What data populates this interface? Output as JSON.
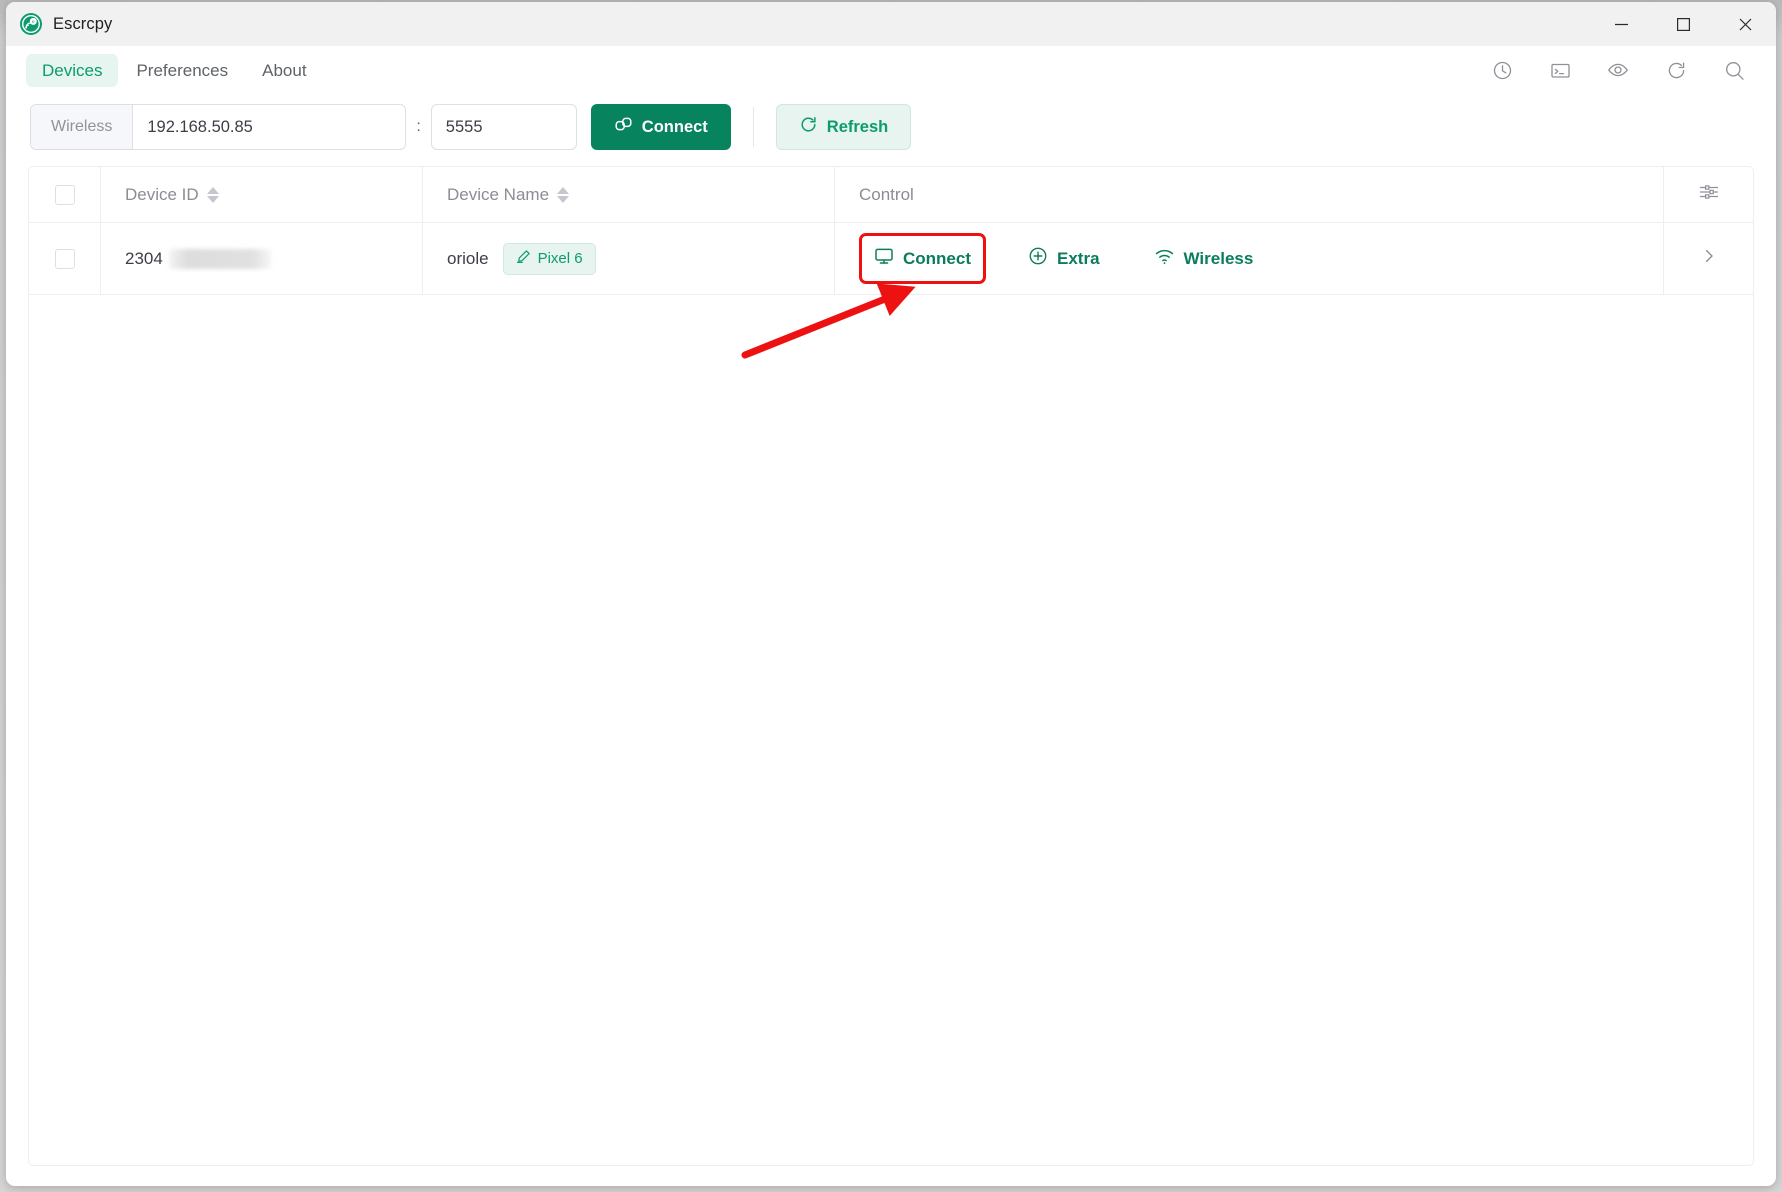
{
  "window": {
    "title": "Escrcpy",
    "logo_icon": "escrcpy-logo-icon",
    "controls": {
      "minimize": "minimize-icon",
      "maximize": "maximize-icon",
      "close": "close-icon"
    }
  },
  "tabs": [
    {
      "label": "Devices",
      "active": true
    },
    {
      "label": "Preferences",
      "active": false
    },
    {
      "label": "About",
      "active": false
    }
  ],
  "toolbar_icons": [
    {
      "name": "history-icon"
    },
    {
      "name": "terminal-icon"
    },
    {
      "name": "eye-icon"
    },
    {
      "name": "refresh-icon"
    },
    {
      "name": "search-icon"
    }
  ],
  "connect_bar": {
    "mode_label": "Wireless",
    "host_value": "192.168.50.85",
    "host_placeholder": "192.168.50.85",
    "separator": ":",
    "port_value": "5555",
    "port_placeholder": "5555",
    "connect_label": "Connect",
    "connect_icon": "link-icon",
    "refresh_label": "Refresh",
    "refresh_icon": "refresh-icon"
  },
  "table": {
    "columns": [
      {
        "key": "device_id",
        "label": "Device ID",
        "sortable": true
      },
      {
        "key": "device_name",
        "label": "Device Name",
        "sortable": true
      },
      {
        "key": "control",
        "label": "Control",
        "sortable": false
      }
    ],
    "settings_icon": "sliders-icon",
    "rows": [
      {
        "selected": false,
        "device_id": "2304",
        "device_id_redacted": true,
        "device_name": "oriole",
        "device_tag": "Pixel 6",
        "device_tag_icon": "pencil-icon",
        "controls": [
          {
            "label": "Connect",
            "icon": "monitor-icon",
            "highlighted": true
          },
          {
            "label": "Extra",
            "icon": "plus-circle-icon",
            "highlighted": false
          },
          {
            "label": "Wireless",
            "icon": "wifi-icon",
            "highlighted": false
          }
        ],
        "expand_icon": "chevron-right-icon"
      }
    ]
  },
  "annotation": {
    "arrow_color": "#ee1111",
    "highlight_color": "#ee1111",
    "target": "Connect"
  },
  "colors": {
    "brand_green": "#0c9b6f",
    "primary_button": "#07845e",
    "tab_active_bg": "#e6f5ef",
    "muted_text": "#8a8d93",
    "border": "#ebeef5"
  }
}
